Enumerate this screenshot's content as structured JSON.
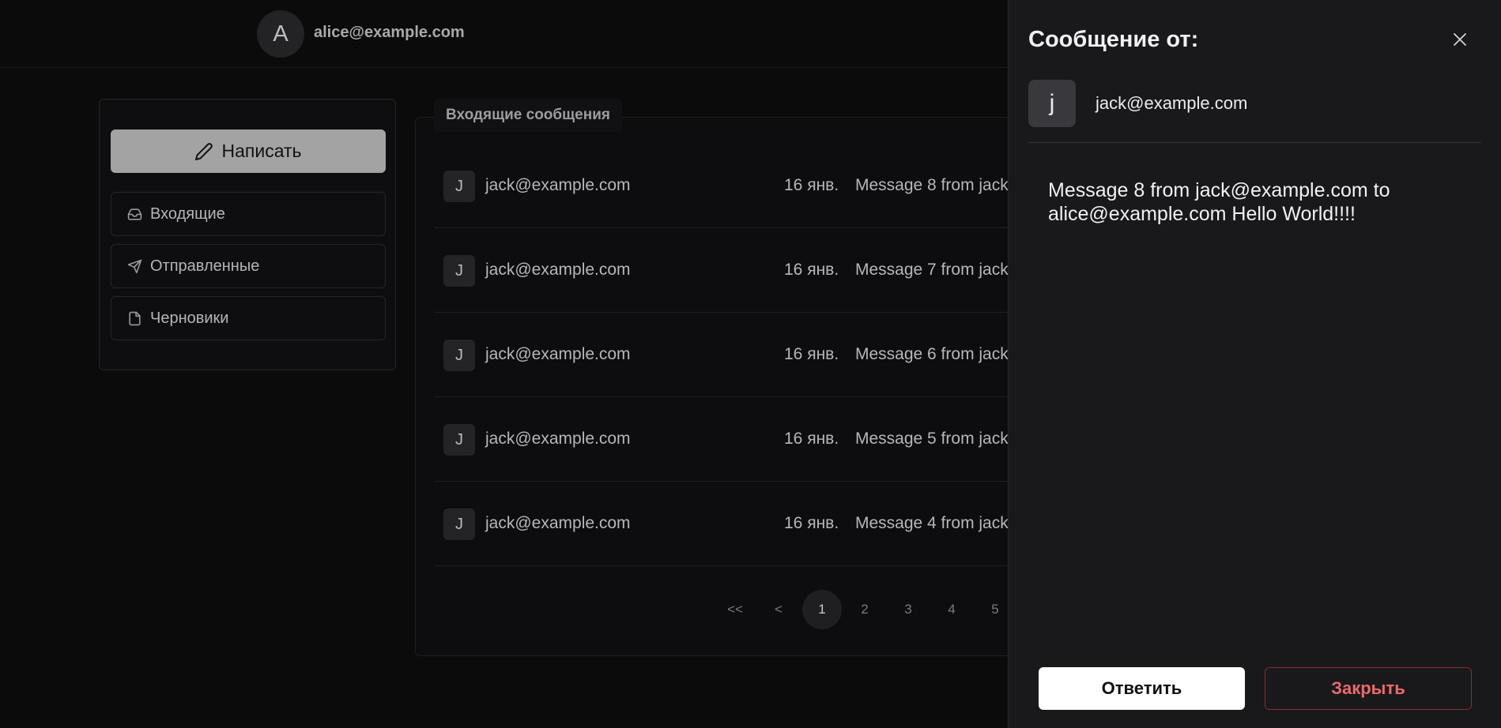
{
  "header": {
    "avatar_letter": "A",
    "user_email": "alice@example.com"
  },
  "sidebar": {
    "compose_label": "Написать",
    "items": [
      {
        "label": "Входящие",
        "icon": "inbox-icon"
      },
      {
        "label": "Отправленные",
        "icon": "send-icon"
      },
      {
        "label": "Черновики",
        "icon": "file-icon"
      }
    ]
  },
  "inbox": {
    "title": "Входящие сообщения",
    "messages": [
      {
        "avatar": "J",
        "from": "jack@example.com",
        "date": "16 янв.",
        "subject": "Message 8 from jack"
      },
      {
        "avatar": "J",
        "from": "jack@example.com",
        "date": "16 янв.",
        "subject": "Message 7 from jack"
      },
      {
        "avatar": "J",
        "from": "jack@example.com",
        "date": "16 янв.",
        "subject": "Message 6 from jack"
      },
      {
        "avatar": "J",
        "from": "jack@example.com",
        "date": "16 янв.",
        "subject": "Message 5 from jack"
      },
      {
        "avatar": "J",
        "from": "jack@example.com",
        "date": "16 янв.",
        "subject": "Message 4 from jack"
      }
    ],
    "pagination": {
      "first": "<<",
      "prev": "<",
      "pages": [
        "1",
        "2",
        "3",
        "4",
        "5"
      ],
      "current": "1"
    }
  },
  "drawer": {
    "title": "Сообщение от:",
    "sender_avatar": "j",
    "sender_email": "jack@example.com",
    "body": "Message 8 from jack@example.com to alice@example.com Hello World!!!!",
    "reply_label": "Ответить",
    "close_label": "Закрыть"
  },
  "colors": {
    "background": "#0b0b0c",
    "drawer_background": "#19191b",
    "danger": "#ea6a6c",
    "compose_button": "#a3a3a3"
  }
}
